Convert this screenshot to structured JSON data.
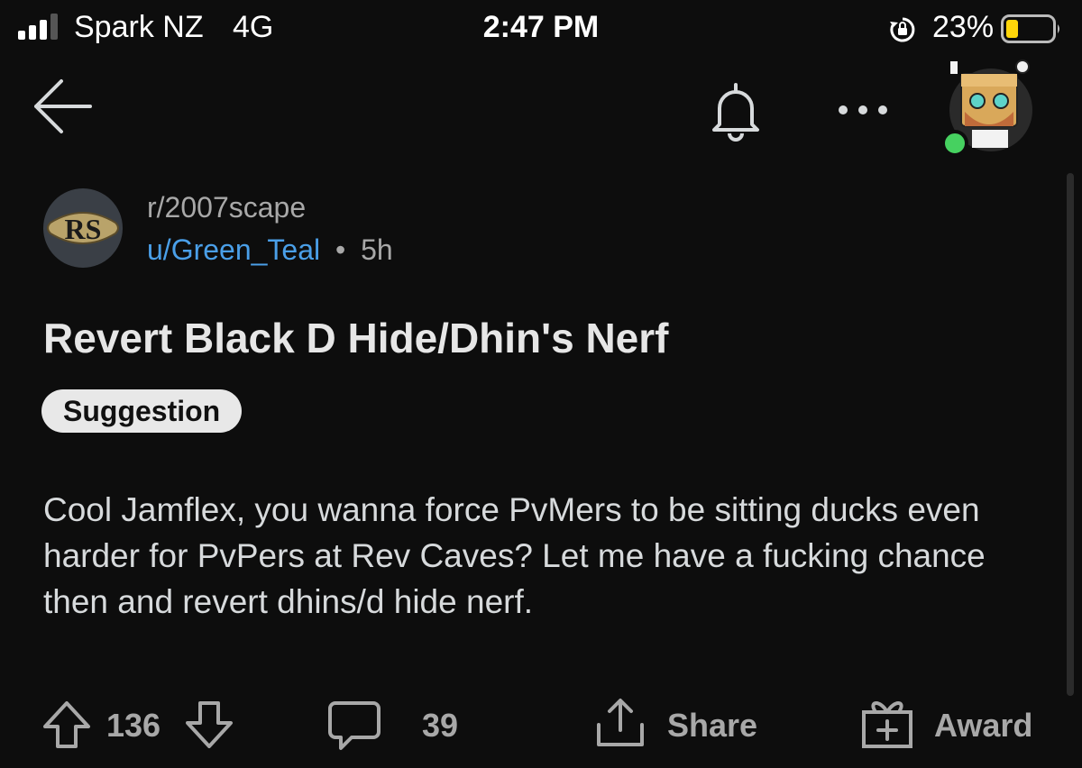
{
  "status_bar": {
    "carrier": "Spark NZ",
    "network": "4G",
    "time": "2:47 PM",
    "battery_percent": "23%",
    "signal_bars": 3
  },
  "nav": {
    "icons": [
      "back-arrow-icon",
      "bell-icon",
      "more-icon",
      "avatar"
    ]
  },
  "post": {
    "subreddit": "r/2007scape",
    "subreddit_icon_text": "RS",
    "author": "u/Green_Teal",
    "separator": "•",
    "age": "5h",
    "title": "Revert Black D Hide/Dhin's Nerf",
    "flair": "Suggestion",
    "body": "Cool Jamflex, you wanna force PvMers to be sitting ducks even harder for PvPers at Rev Caves? Let me have a fucking chance then and revert dhins/d hide nerf."
  },
  "actions": {
    "score": "136",
    "comments": "39",
    "share_label": "Share",
    "award_label": "Award"
  },
  "colors": {
    "background": "#0d0d0d",
    "author_link": "#4a9fe8",
    "online": "#46d160",
    "battery_low": "#ffd60a"
  }
}
